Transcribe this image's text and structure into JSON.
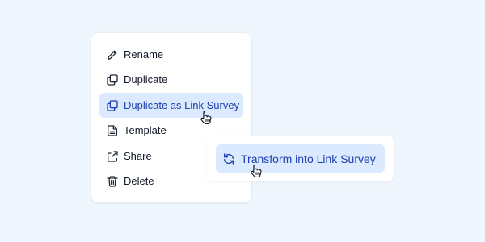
{
  "context_menu": {
    "items": [
      {
        "label": "Rename",
        "icon": "pencil-icon"
      },
      {
        "label": "Duplicate",
        "icon": "duplicate-icon"
      },
      {
        "label": "Duplicate as Link Survey",
        "icon": "duplicate-icon"
      },
      {
        "label": "Template",
        "icon": "document-icon"
      },
      {
        "label": "Share",
        "icon": "share-icon"
      },
      {
        "label": "Delete",
        "icon": "trash-icon"
      }
    ]
  },
  "popover": {
    "action_label": "Transform into Link Survey",
    "icon": "refresh-icon"
  },
  "colors": {
    "background": "#eff6fd",
    "highlight": "#dbeafe",
    "accent_text": "#1e40af"
  }
}
